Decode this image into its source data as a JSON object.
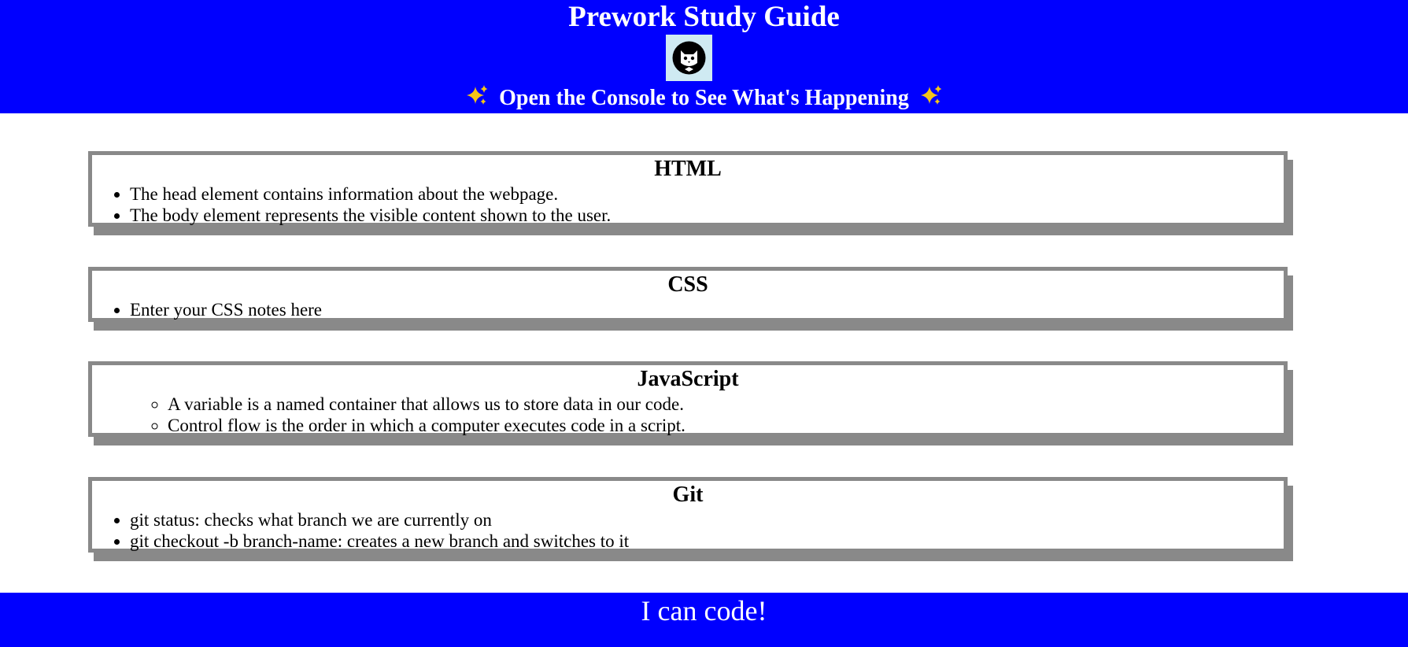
{
  "header": {
    "title": "Prework Study Guide",
    "logo_icon": "cat-avatar-icon",
    "subtitle_prefix_icon": "sparkles-icon",
    "subtitle": "Open the Console to See What's Happening",
    "subtitle_suffix_icon": "sparkles-icon"
  },
  "sections": [
    {
      "title": "HTML",
      "items": [
        "The head element contains information about the webpage.",
        "The body element represents the visible content shown to the user."
      ]
    },
    {
      "title": "CSS",
      "items": [
        "Enter your CSS notes here"
      ]
    },
    {
      "title": "JavaScript",
      "items": [
        "A variable is a named container that allows us to store data in our code.",
        "Control flow is the order in which a computer executes code in a script."
      ]
    },
    {
      "title": "Git",
      "items": [
        "git status: checks what branch we are currently on",
        "git checkout -b branch-name: creates a new branch and switches to it"
      ]
    }
  ],
  "footer": {
    "text": "I can code!"
  },
  "colors": {
    "header_bg": "#0000ff",
    "footer_bg": "#0000ff",
    "card_border": "#898989",
    "sparkle": "#f5c518"
  }
}
